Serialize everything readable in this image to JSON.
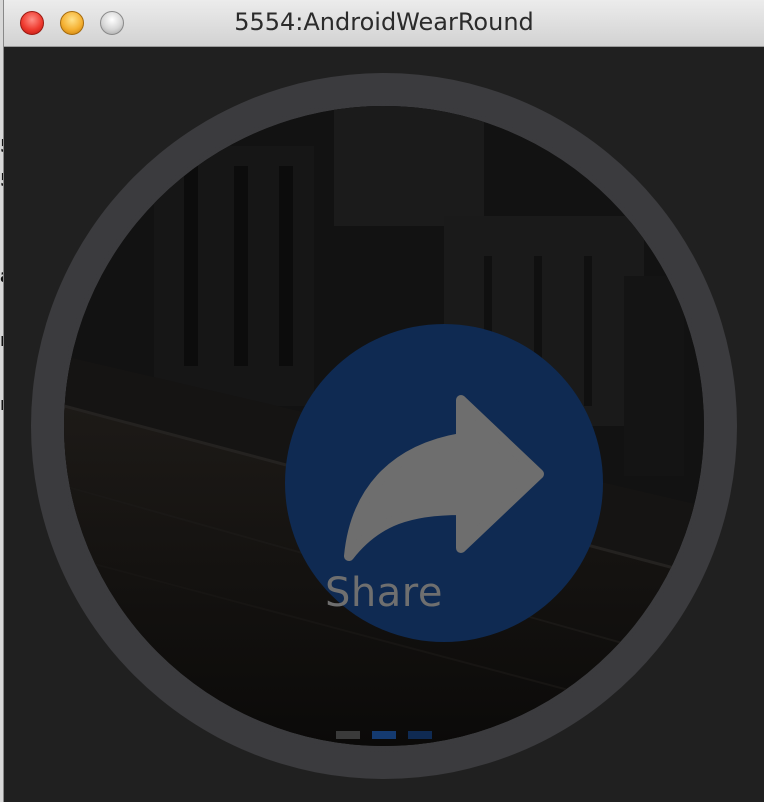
{
  "background_window": {
    "fragments": [
      "5",
      "5",
      "a",
      "n",
      "r"
    ]
  },
  "window": {
    "title": "5554:AndroidWearRound",
    "controls": {
      "close_icon": "close-traffic-light",
      "minimize_icon": "minimize-traffic-light",
      "zoom_icon": "zoom-traffic-light"
    }
  },
  "watch": {
    "action": {
      "label": "Share",
      "icon": "share-arrow-icon",
      "circle_color": "#0f2a52"
    },
    "pager": {
      "page_count": 3,
      "current_page": 2,
      "active_color": "#143a70",
      "inactive_color": "#3a3a3a"
    }
  }
}
